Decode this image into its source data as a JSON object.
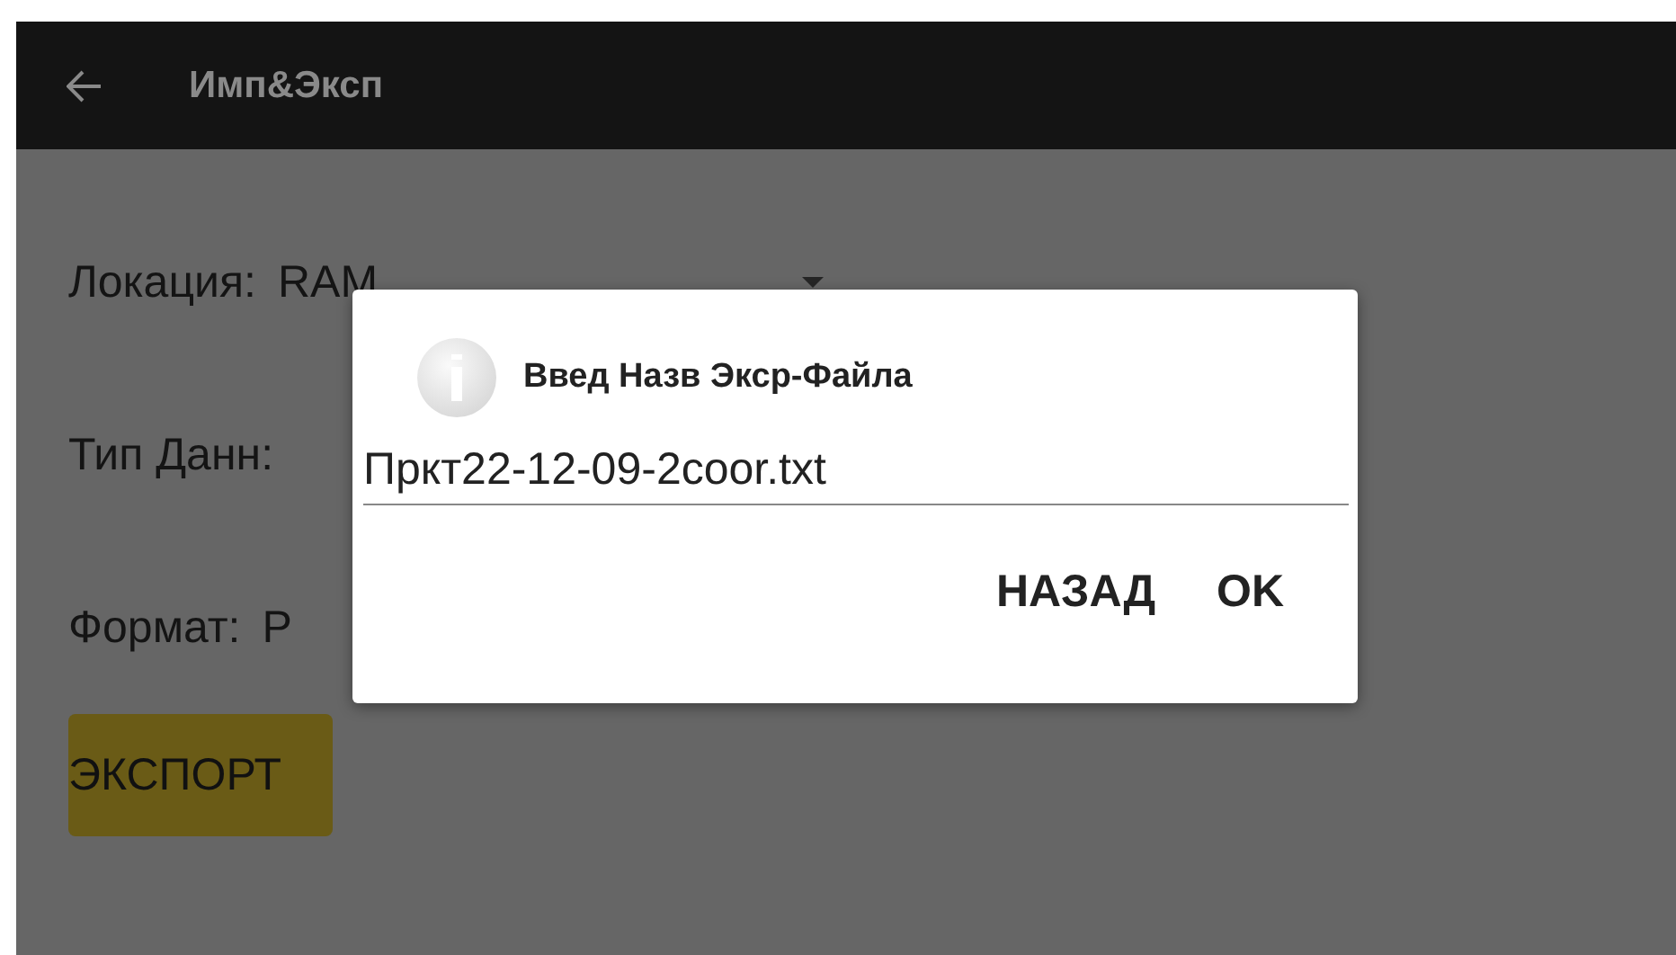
{
  "app_bar": {
    "title": "Имп&Эксп"
  },
  "fields": [
    {
      "kind": "dropdown",
      "label": "Локация:",
      "value": "RAM"
    },
    {
      "kind": "plain",
      "label": "Тип Данн:"
    },
    {
      "kind": "plain",
      "label": "Формат:",
      "value": "Р"
    }
  ],
  "export_button": "ЭКСПОРТ",
  "dialog": {
    "title": "Введ Назв Экср-Файла",
    "value": "Пркт22-12-09-2coor.txt",
    "buttons": [
      "НАЗАД",
      "OK"
    ]
  }
}
